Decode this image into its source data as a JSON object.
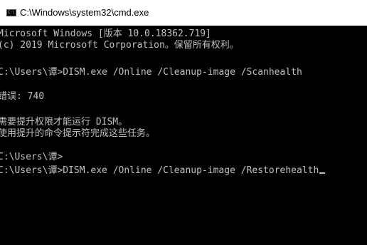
{
  "window": {
    "title": "C:\\Windows\\system32\\cmd.exe",
    "icon": "cmd-icon"
  },
  "console": {
    "lines": [
      "Microsoft Windows [版本 10.0.18362.719]",
      "(c) 2019 Microsoft Corporation。保留所有权利。",
      "",
      "C:\\Users\\谭>DISM.exe /Online /Cleanup-image /Scanhealth",
      "",
      "错误: 740",
      "",
      "需要提升权限才能运行 DISM。",
      "使用提升的命令提示符完成这些任务。",
      "",
      "C:\\Users\\谭>",
      "C:\\Users\\谭>DISM.exe /Online /Cleanup-image /Restorehealth"
    ]
  },
  "colors": {
    "console_background": "#000000",
    "console_text": "#c0c0c0",
    "titlebar_background": "#ffffff"
  }
}
